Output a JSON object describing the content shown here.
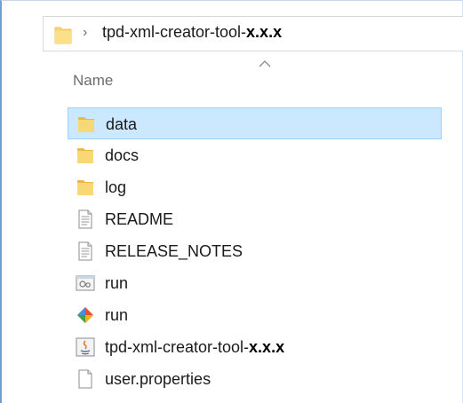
{
  "address_bar": {
    "separator": "›",
    "path_prefix": "tpd-xml-creator-tool-",
    "path_version": "x.x.x"
  },
  "header": {
    "name_column": "Name",
    "sort_indicator": "up-caret"
  },
  "colors": {
    "selection_fill": "#cce8ff",
    "selection_border": "#99d1ff",
    "folder_yellow": "#f8d775",
    "accent_border": "#6f9fd6"
  },
  "files": [
    {
      "name": "data",
      "suffix": "",
      "icon": "folder-icon",
      "selected": true
    },
    {
      "name": "docs",
      "suffix": "",
      "icon": "folder-icon",
      "selected": false
    },
    {
      "name": "log",
      "suffix": "",
      "icon": "folder-icon",
      "selected": false
    },
    {
      "name": "README",
      "suffix": "",
      "icon": "text-file-icon",
      "selected": false
    },
    {
      "name": "RELEASE_NOTES",
      "suffix": "",
      "icon": "text-file-icon",
      "selected": false
    },
    {
      "name": "run",
      "suffix": "",
      "icon": "batch-file-icon",
      "selected": false
    },
    {
      "name": "run",
      "suffix": "",
      "icon": "git-bash-icon",
      "selected": false
    },
    {
      "name": "tpd-xml-creator-tool-",
      "suffix": "x.x.x",
      "icon": "java-jar-icon",
      "selected": false
    },
    {
      "name": "user.properties",
      "suffix": "",
      "icon": "blank-file-icon",
      "selected": false
    }
  ]
}
